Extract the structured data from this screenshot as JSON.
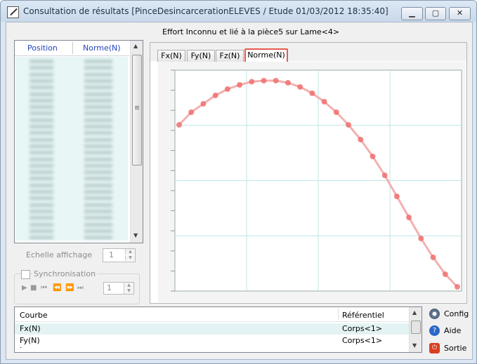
{
  "window": {
    "title": "Consultation de résultats [PinceDesincarcerationELEVES / Etude 01/03/2012 18:35:40]",
    "controls": {
      "minimize": "▁",
      "maximize": "▢",
      "close": "✕"
    }
  },
  "list": {
    "headers": [
      "Position",
      "Norme(N)"
    ],
    "row_count": 28
  },
  "display": {
    "scale_label": "Echelle affichage",
    "scale_value": "1",
    "sync_label": "Synchronisation",
    "sync_checked": false,
    "step_value": "1",
    "media_icons": [
      "play-icon",
      "stop-icon",
      "first-icon",
      "prev-icon",
      "next-icon",
      "last-icon"
    ]
  },
  "chart": {
    "caption": "Effort Inconnu et lié à la pièce5 sur Lame<4>",
    "tabs": [
      "Fx(N)",
      "Fy(N)",
      "Fz(N)",
      "Norme(N)"
    ],
    "active_tab": "Norme(N)"
  },
  "chart_data": {
    "type": "line",
    "title": "",
    "xlabel": "",
    "ylabel": "",
    "x": [
      0,
      1,
      2,
      3,
      4,
      5,
      6,
      7,
      8,
      9,
      10,
      11,
      12,
      13,
      14,
      15,
      16,
      17,
      18,
      19,
      20,
      21,
      22,
      23
    ],
    "series": [
      {
        "values": [
          0.79,
          0.85,
          0.89,
          0.93,
          0.96,
          0.98,
          0.995,
          1.0,
          1.0,
          0.99,
          0.97,
          0.94,
          0.9,
          0.85,
          0.79,
          0.72,
          0.64,
          0.55,
          0.45,
          0.35,
          0.25,
          0.16,
          0.08,
          0.02
        ]
      }
    ],
    "ylim": [
      0,
      1.05
    ],
    "grid": true,
    "color": "#ef6b6b"
  },
  "curves": {
    "headers": {
      "curve": "Courbe",
      "ref": "Référentiel"
    },
    "rows": [
      {
        "curve": "Fx(N)",
        "ref": "Corps<1>"
      },
      {
        "curve": "Fy(N)",
        "ref": "Corps<1>"
      }
    ]
  },
  "actions": {
    "config": "Config",
    "help": "Aide",
    "exit": "Sortie"
  }
}
